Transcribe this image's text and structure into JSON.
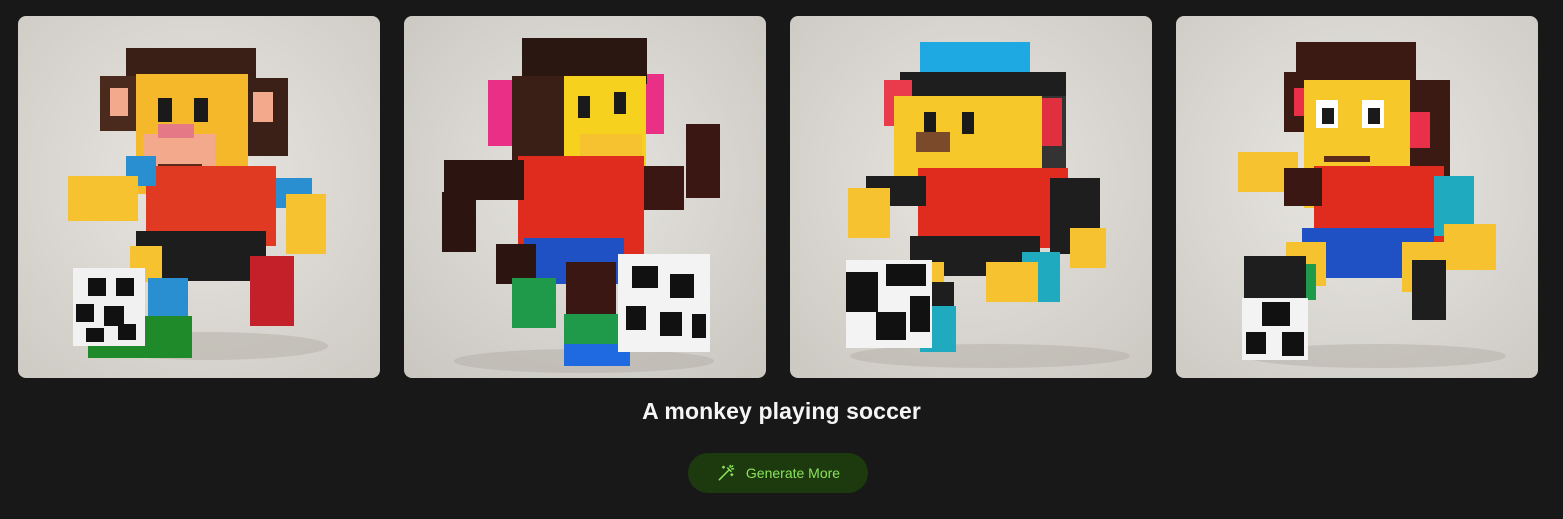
{
  "gallery": {
    "images": [
      {
        "icon": "lego-monkey-soccer-image-1"
      },
      {
        "icon": "lego-monkey-soccer-image-2"
      },
      {
        "icon": "lego-monkey-soccer-image-3"
      },
      {
        "icon": "lego-monkey-soccer-image-4"
      }
    ]
  },
  "prompt": {
    "caption": "A monkey playing soccer"
  },
  "actions": {
    "generate_label": "Generate More",
    "generate_icon": "magic-wand-icon"
  },
  "colors": {
    "background": "#181818",
    "button_bg": "#1d3a0e",
    "button_text": "#8be35a"
  }
}
